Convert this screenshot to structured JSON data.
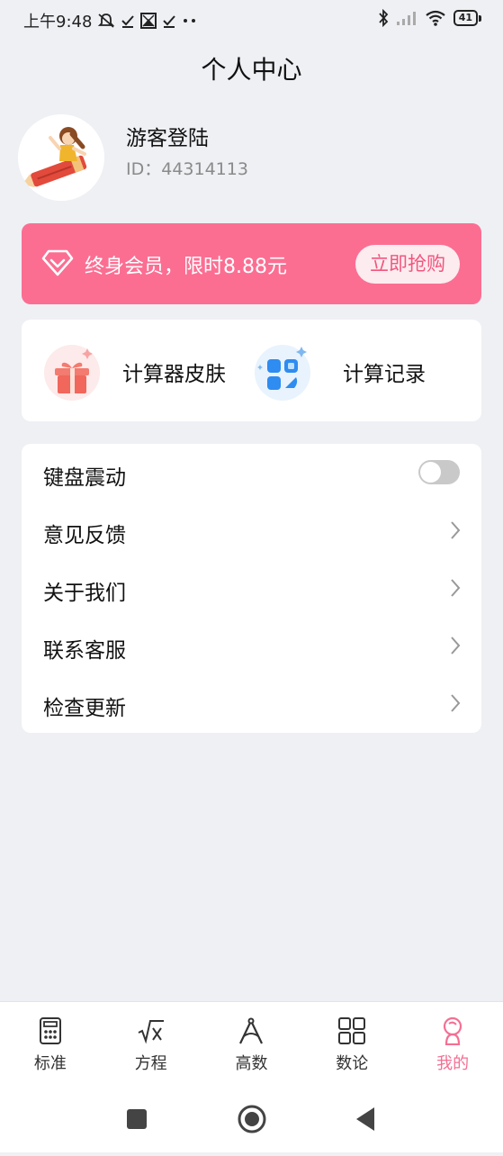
{
  "status_bar": {
    "time": "上午9:48",
    "battery": "41"
  },
  "header": {
    "title": "个人中心"
  },
  "profile": {
    "username": "游客登陆",
    "user_id": "ID：44314113"
  },
  "vip": {
    "text": "终身会员，限时8.88元",
    "button_label": "立即抢购"
  },
  "features": [
    {
      "label": "计算器皮肤",
      "icon": "gift-icon"
    },
    {
      "label": "计算记录",
      "icon": "grid-apps-icon"
    }
  ],
  "settings": {
    "items": [
      {
        "label": "键盘震动",
        "control": "toggle",
        "enabled": false
      },
      {
        "label": "意见反馈",
        "control": "chevron"
      },
      {
        "label": "关于我们",
        "control": "chevron"
      },
      {
        "label": "联系客服",
        "control": "chevron"
      },
      {
        "label": "检查更新",
        "control": "chevron"
      }
    ]
  },
  "bottom_nav": {
    "items": [
      {
        "label": "标准",
        "icon": "calculator-icon"
      },
      {
        "label": "方程",
        "icon": "sqrt-icon"
      },
      {
        "label": "高数",
        "icon": "compass-icon"
      },
      {
        "label": "数论",
        "icon": "grid-icon"
      },
      {
        "label": "我的",
        "icon": "user-icon",
        "active": true
      }
    ]
  },
  "colors": {
    "accent": "#f46f93",
    "vip_banner": "#fb6e92",
    "background": "#eef0f4"
  }
}
